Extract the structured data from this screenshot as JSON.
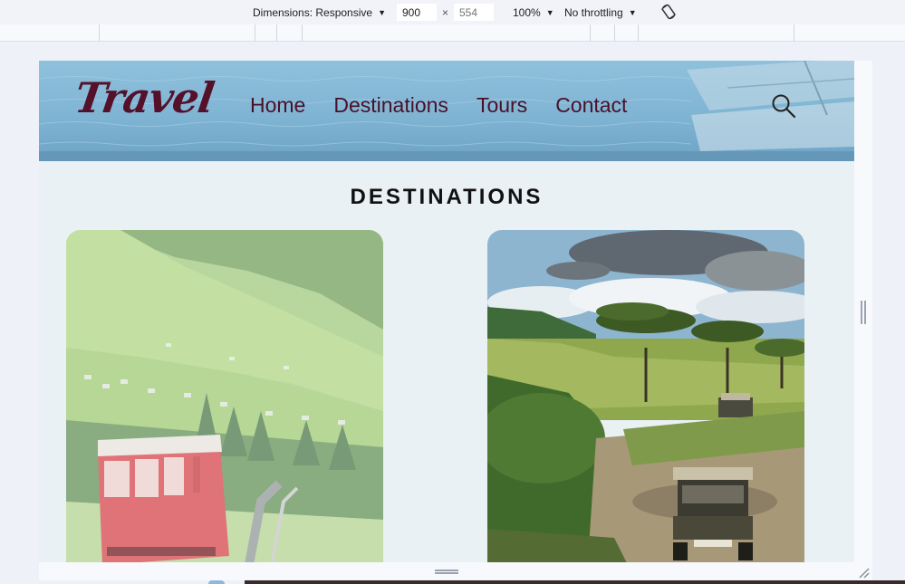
{
  "devtools": {
    "dimensions_label": "Dimensions: Responsive",
    "width_value": "900",
    "height_value": "554",
    "times": "×",
    "zoom": "100%",
    "throttling": "No throttling"
  },
  "site": {
    "logo": "Travel",
    "nav": [
      "Home",
      "Destinations",
      "Tours",
      "Contact"
    ],
    "section_title": "DESTINATIONS"
  },
  "icons": {
    "search": "search-icon",
    "rotate": "rotate-icon"
  },
  "colors": {
    "brand": "#55102a",
    "nav_text": "#4a1029",
    "header_bg": "#7fb4d3",
    "page_bg": "#eaf1f4"
  }
}
